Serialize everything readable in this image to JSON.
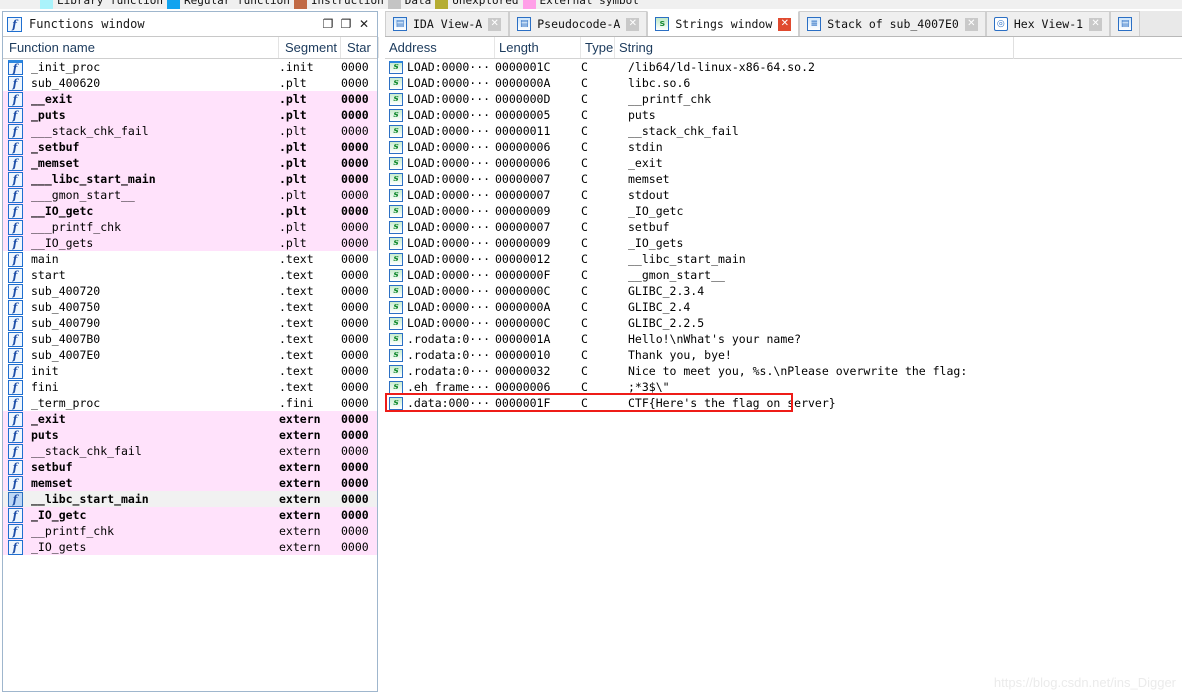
{
  "legend": {
    "items": [
      {
        "label": "Library function",
        "color": "#aaf3fb"
      },
      {
        "label": "Regular function",
        "color": "#12a3ef"
      },
      {
        "label": "Instruction",
        "color": "#c16a45"
      },
      {
        "label": "Data",
        "color": "#c4c4c4"
      },
      {
        "label": "Unexplored",
        "color": "#b5ad33"
      },
      {
        "label": "External symbol",
        "color": "#ff9fe8"
      }
    ]
  },
  "functions_window": {
    "title": "Functions window",
    "icon": "function-icon",
    "window_buttons": {
      "maximize": "❐",
      "restore": "❐",
      "close": "✕"
    },
    "columns": [
      "Function name",
      "Segment",
      "Star"
    ],
    "rows": [
      {
        "name": "_init_proc",
        "segment": ".init",
        "start": "0000",
        "style": "normal"
      },
      {
        "name": "sub_400620",
        "segment": ".plt",
        "start": "0000",
        "style": "normal"
      },
      {
        "name": "__exit",
        "segment": ".plt",
        "start": "0000",
        "style": "pink-bold"
      },
      {
        "name": "_puts",
        "segment": ".plt",
        "start": "0000",
        "style": "pink-bold"
      },
      {
        "name": "___stack_chk_fail",
        "segment": ".plt",
        "start": "0000",
        "style": "pink"
      },
      {
        "name": "_setbuf",
        "segment": ".plt",
        "start": "0000",
        "style": "pink-bold"
      },
      {
        "name": "_memset",
        "segment": ".plt",
        "start": "0000",
        "style": "pink-bold"
      },
      {
        "name": "___libc_start_main",
        "segment": ".plt",
        "start": "0000",
        "style": "pink-bold"
      },
      {
        "name": "___gmon_start__",
        "segment": ".plt",
        "start": "0000",
        "style": "pink"
      },
      {
        "name": "__IO_getc",
        "segment": ".plt",
        "start": "0000",
        "style": "pink-bold"
      },
      {
        "name": "___printf_chk",
        "segment": ".plt",
        "start": "0000",
        "style": "pink"
      },
      {
        "name": "__IO_gets",
        "segment": ".plt",
        "start": "0000",
        "style": "pink"
      },
      {
        "name": "main",
        "segment": ".text",
        "start": "0000",
        "style": "normal"
      },
      {
        "name": "start",
        "segment": ".text",
        "start": "0000",
        "style": "normal"
      },
      {
        "name": "sub_400720",
        "segment": ".text",
        "start": "0000",
        "style": "normal"
      },
      {
        "name": "sub_400750",
        "segment": ".text",
        "start": "0000",
        "style": "normal"
      },
      {
        "name": "sub_400790",
        "segment": ".text",
        "start": "0000",
        "style": "normal"
      },
      {
        "name": "sub_4007B0",
        "segment": ".text",
        "start": "0000",
        "style": "normal"
      },
      {
        "name": "sub_4007E0",
        "segment": ".text",
        "start": "0000",
        "style": "normal"
      },
      {
        "name": "init",
        "segment": ".text",
        "start": "0000",
        "style": "normal"
      },
      {
        "name": "fini",
        "segment": ".text",
        "start": "0000",
        "style": "normal"
      },
      {
        "name": "_term_proc",
        "segment": ".fini",
        "start": "0000",
        "style": "normal"
      },
      {
        "name": "_exit",
        "segment": "extern",
        "start": "0000",
        "style": "pink-bold"
      },
      {
        "name": "puts",
        "segment": "extern",
        "start": "0000",
        "style": "pink-bold"
      },
      {
        "name": "__stack_chk_fail",
        "segment": "extern",
        "start": "0000",
        "style": "pink"
      },
      {
        "name": "setbuf",
        "segment": "extern",
        "start": "0000",
        "style": "pink-bold"
      },
      {
        "name": "memset",
        "segment": "extern",
        "start": "0000",
        "style": "pink-bold"
      },
      {
        "name": "__libc_start_main",
        "segment": "extern",
        "start": "0000",
        "style": "selected-bold"
      },
      {
        "name": "_IO_getc",
        "segment": "extern",
        "start": "0000",
        "style": "pink-bold"
      },
      {
        "name": "__printf_chk",
        "segment": "extern",
        "start": "0000",
        "style": "pink"
      },
      {
        "name": "_IO_gets",
        "segment": "extern",
        "start": "0000",
        "style": "pink"
      }
    ]
  },
  "tabs": [
    {
      "label": "IDA View-A",
      "icon": "doc-icon",
      "active": false,
      "close": "✕",
      "close_style": "grey"
    },
    {
      "label": "Pseudocode-A",
      "icon": "doc-icon",
      "active": false,
      "close": "✕",
      "close_style": "grey"
    },
    {
      "label": "Strings window",
      "icon": "string-icon",
      "active": true,
      "close": "✕",
      "close_style": "red"
    },
    {
      "label": "Stack of sub_4007E0",
      "icon": "stack-icon",
      "active": false,
      "close": "✕",
      "close_style": "grey"
    },
    {
      "label": "Hex View-1",
      "icon": "hex-icon",
      "active": false,
      "close": "✕",
      "close_style": "grey"
    }
  ],
  "strings_window": {
    "columns": [
      "Address",
      "Length",
      "Type",
      "String"
    ],
    "rows": [
      {
        "address": "LOAD:0000···",
        "length": "0000001C",
        "type": "C",
        "string": "/lib64/ld-linux-x86-64.so.2"
      },
      {
        "address": "LOAD:0000···",
        "length": "0000000A",
        "type": "C",
        "string": "libc.so.6"
      },
      {
        "address": "LOAD:0000···",
        "length": "0000000D",
        "type": "C",
        "string": "__printf_chk"
      },
      {
        "address": "LOAD:0000···",
        "length": "00000005",
        "type": "C",
        "string": "puts"
      },
      {
        "address": "LOAD:0000···",
        "length": "00000011",
        "type": "C",
        "string": "__stack_chk_fail"
      },
      {
        "address": "LOAD:0000···",
        "length": "00000006",
        "type": "C",
        "string": "stdin"
      },
      {
        "address": "LOAD:0000···",
        "length": "00000006",
        "type": "C",
        "string": "_exit"
      },
      {
        "address": "LOAD:0000···",
        "length": "00000007",
        "type": "C",
        "string": "memset"
      },
      {
        "address": "LOAD:0000···",
        "length": "00000007",
        "type": "C",
        "string": "stdout"
      },
      {
        "address": "LOAD:0000···",
        "length": "00000009",
        "type": "C",
        "string": "_IO_getc"
      },
      {
        "address": "LOAD:0000···",
        "length": "00000007",
        "type": "C",
        "string": "setbuf"
      },
      {
        "address": "LOAD:0000···",
        "length": "00000009",
        "type": "C",
        "string": "_IO_gets"
      },
      {
        "address": "LOAD:0000···",
        "length": "00000012",
        "type": "C",
        "string": "__libc_start_main"
      },
      {
        "address": "LOAD:0000···",
        "length": "0000000F",
        "type": "C",
        "string": "__gmon_start__"
      },
      {
        "address": "LOAD:0000···",
        "length": "0000000C",
        "type": "C",
        "string": "GLIBC_2.3.4"
      },
      {
        "address": "LOAD:0000···",
        "length": "0000000A",
        "type": "C",
        "string": "GLIBC_2.4"
      },
      {
        "address": "LOAD:0000···",
        "length": "0000000C",
        "type": "C",
        "string": "GLIBC_2.2.5"
      },
      {
        "address": ".rodata:0···",
        "length": "0000001A",
        "type": "C",
        "string": "Hello!\\nWhat's your name?"
      },
      {
        "address": ".rodata:0···",
        "length": "00000010",
        "type": "C",
        "string": "Thank you, bye!"
      },
      {
        "address": ".rodata:0···",
        "length": "00000032",
        "type": "C",
        "string": "Nice to meet you, %s.\\nPlease overwrite the flag:"
      },
      {
        "address": ".eh_frame···",
        "length": "00000006",
        "type": "C",
        "string": ";*3$\\\""
      },
      {
        "address": ".data:000···",
        "length": "0000001F",
        "type": "C",
        "string": "CTF{Here's the flag on server}",
        "highlighted": true
      }
    ],
    "highlight_color": "#ee1c18"
  },
  "watermark": "https://blog.csdn.net/ins_Digger"
}
